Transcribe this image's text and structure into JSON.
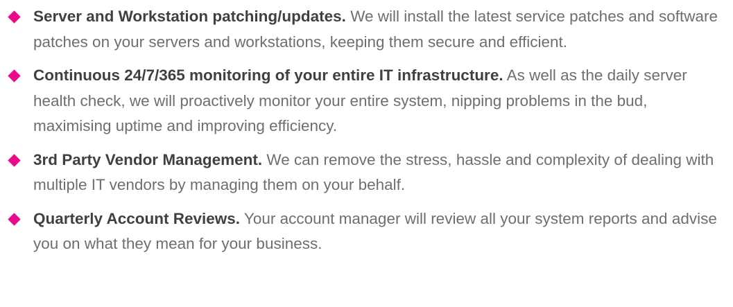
{
  "colors": {
    "bullet": "#ec0a8c",
    "heading_text": "#404040",
    "body_text": "#6e6e6e"
  },
  "bullet_icon": "diamond-icon",
  "services": [
    {
      "heading": "Server and Workstation patching/updates.",
      "description": "We will install the latest service patches and software patches on your servers and workstations, keeping them secure and efficient."
    },
    {
      "heading": "Continuous 24/7/365 monitoring of your entire IT infrastructure.",
      "description": "As well as the daily server health check, we will proactively monitor your entire system, nipping problems in the bud, maximising uptime and improving efficiency."
    },
    {
      "heading": "3rd Party Vendor Management.",
      "description": "We can remove the stress, hassle and complexity of dealing with multiple IT vendors by managing them on your behalf."
    },
    {
      "heading": "Quarterly Account Reviews.",
      "description": "Your account manager will review all your system reports and advise you on what they mean for your business."
    }
  ]
}
